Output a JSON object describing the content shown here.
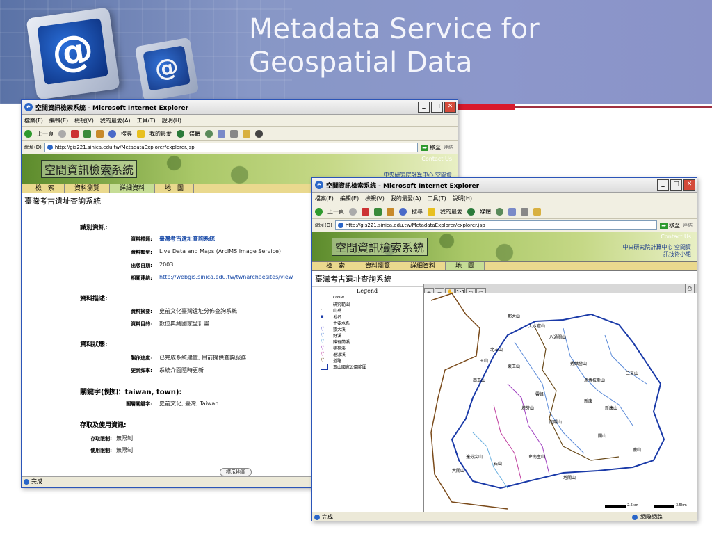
{
  "slide": {
    "title_line1": "Metadata Service for",
    "title_line2": "Geospatial Data",
    "logo_symbol": "@"
  },
  "browser1": {
    "title": "空間資訊檢索系統 - Microsoft Internet Explorer",
    "menu": [
      "檔案(F)",
      "編輯(E)",
      "檢視(V)",
      "我的最愛(A)",
      "工具(T)",
      "說明(H)"
    ],
    "toolbar": {
      "back": "上一頁",
      "search": "搜尋",
      "favorites": "我的最愛",
      "media": "媒體"
    },
    "address_label": "網址(D)",
    "url": "http://gis221.sinica.edu.tw/MetadataExplorer/explorer.jsp",
    "go": "移至",
    "links": "連結",
    "banner_title": "空間資訊檢索系統",
    "contact": "Contact Us",
    "org": "中央研究院計算中心 空間資",
    "tabs": [
      "檢　索",
      "資料瀏覽",
      "詳細資料",
      "地　圖"
    ],
    "page_heading": "臺灣考古遺址查詢系統",
    "sections": {
      "identification": "識別資訊:",
      "description": "資料描述:",
      "status": "資料狀態:",
      "keywords": "關鍵字(例如：taiwan, town):",
      "access": "存取及使用資訊:"
    },
    "fields": {
      "title_label": "資料標題:",
      "title_value": "臺灣考古遺址查詢系統",
      "type_label": "資料類型:",
      "type_value": "Live Data and Maps (ArcIMS Image Service)",
      "pubdate_label": "出版日期:",
      "pubdate_value": "2003",
      "link_label": "相關連結:",
      "link_value": "http://webgis.sinica.edu.tw/twnarchaesites/view",
      "abstract_label": "資料摘要:",
      "abstract_value": "史前文化臺灣遺址分佈查詢系統",
      "purpose_label": "資料目的:",
      "purpose_value": "數位典藏國家型計畫",
      "progress_label": "製作進度:",
      "progress_value": "已完成系統建置, 目前提供查詢服務.",
      "freq_label": "更新頻率:",
      "freq_value": "系統介面隨時更新",
      "theme_label": "圖層關鍵字:",
      "theme_value": "史前文化, 臺灣, Taiwan",
      "accconst_label": "存取限制:",
      "accconst_value": "無限制",
      "useconst_label": "使用限制:",
      "useconst_value": "無限制"
    },
    "button_partial": "標示地圖",
    "status": "完成"
  },
  "browser2": {
    "title": "空間資訊檢索系統 - Microsoft Internet Explorer",
    "menu": [
      "檔案(F)",
      "編輯(E)",
      "檢視(V)",
      "我的最愛(A)",
      "工具(T)",
      "說明(H)"
    ],
    "toolbar": {
      "back": "上一頁",
      "search": "搜尋",
      "favorites": "我的最愛",
      "media": "媒體"
    },
    "address_label": "網址(D)",
    "url": "http://gis221.sinica.edu.tw/MetadataExplorer/explorer.jsp",
    "go": "移至",
    "links": "連結",
    "banner_title": "空間資訊檢索系統",
    "contact": "Contact Us",
    "org1": "中央研究院計算中心 空間資",
    "org2": "訊技術小組",
    "tabs": [
      "檢　索",
      "資料瀏覽",
      "詳細資料",
      "地　圖"
    ],
    "page_heading": "臺灣考古遺址查詢系統",
    "legend": {
      "title": "Legend",
      "items": [
        "cover",
        "研究範圍",
        "山岳",
        "地名",
        "主要水系",
        "鄒大溪",
        "野溪",
        "陳有蘭溪",
        "楠梓溪",
        "荖濃溪",
        "道路",
        "玉山國家公園範圍"
      ]
    },
    "map_places": [
      "郡大山",
      "大水窟山",
      "八通關山",
      "玉山",
      "北玉山",
      "東玉山",
      "南玉山",
      "秀姑巒山",
      "馬博拉斯山",
      "新康山",
      "關山",
      "向陽山",
      "塔芬山",
      "雲峰",
      "三叉山",
      "大關山",
      "達芬尖山",
      "石山",
      "卑南主山",
      "鹿山",
      "塔關山",
      "新康"
    ],
    "scale_left": "2.5km",
    "scale_right": "3.5km",
    "status": "完成",
    "status_zone": "網際網路"
  },
  "colors": {
    "accent_red": "#d8192c",
    "header_purple": "#8a93c8",
    "link_blue": "#1a4ba8"
  }
}
